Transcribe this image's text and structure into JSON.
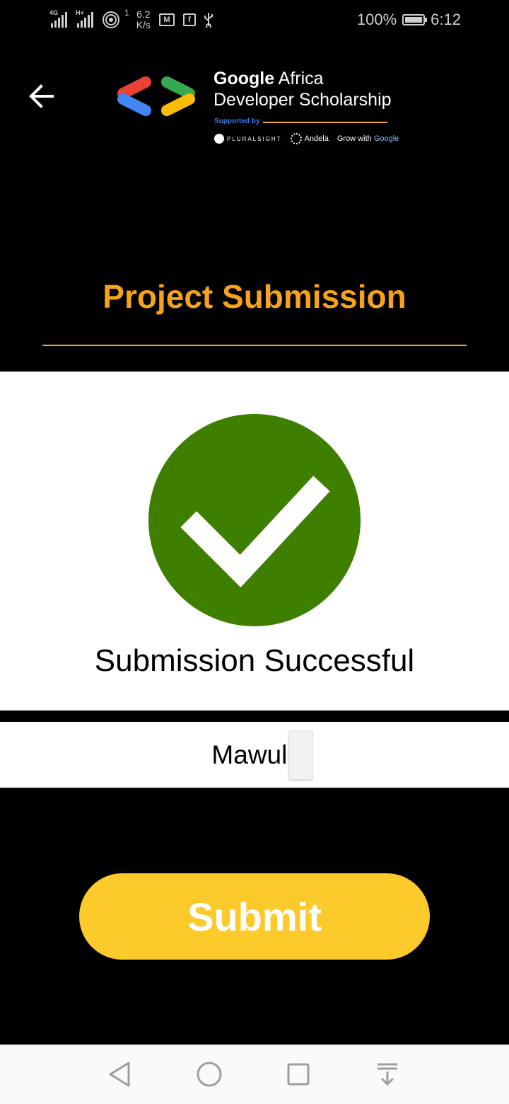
{
  "status_bar": {
    "network_1": "4G",
    "network_2": "H+",
    "data_sim": "1",
    "speed_value": "6.2",
    "speed_unit": "K/s",
    "battery": "100%",
    "time": "6:12",
    "icons": [
      "signal-icon",
      "signal-icon",
      "hotspot-icon",
      "gmail-icon",
      "facebook-icon",
      "usb-icon",
      "battery-icon"
    ]
  },
  "header": {
    "brand_bold": "Google",
    "brand_rest": " Africa",
    "brand_line2": "Developer Scholarship",
    "supported_by": "Supported by",
    "partners": [
      "PLURALSIGHT",
      "Andela",
      "Grow with ",
      "Google"
    ],
    "title": "Project Submission"
  },
  "result": {
    "message": "Submission Successful",
    "name": "Mawuli"
  },
  "actions": {
    "submit_label": "Submit"
  },
  "colors": {
    "accent_orange": "#f6a21c",
    "success_green": "#3e7f00",
    "button_yellow": "#fdca2b",
    "google_red": "#ea4335",
    "google_blue": "#4285f4",
    "google_green": "#34a853",
    "google_yellow": "#fbbc04"
  }
}
